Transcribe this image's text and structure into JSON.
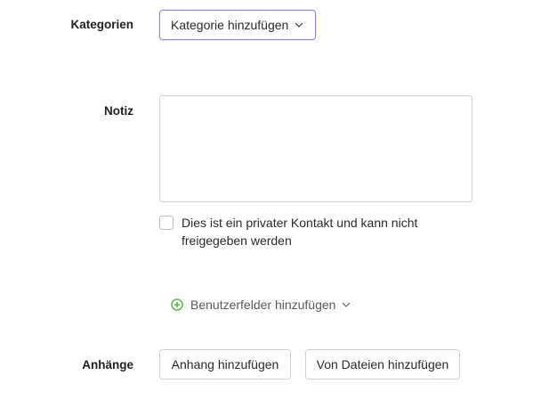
{
  "categories": {
    "label": "Kategorien",
    "dropdown_label": "Kategorie hinzufügen",
    "chevron_icon": "chevron-down-icon"
  },
  "note": {
    "label": "Notiz",
    "value": "",
    "placeholder": ""
  },
  "private_contact": {
    "checked": false,
    "text_line1": "Dies ist ein privater Kontakt und kann nicht",
    "text_line2": "freigegeben werden"
  },
  "custom_fields": {
    "label": "Benutzerfelder hinzufügen",
    "icon": "plus-circle-icon",
    "icon_color": "#3fae2a",
    "chevron_icon": "chevron-down-icon"
  },
  "attachments": {
    "label": "Anhänge",
    "add_button": "Anhang hinzufügen",
    "from_files_button": "Von Dateien hinzufügen"
  },
  "colors": {
    "dropdown_border": "#8e86e8",
    "input_border": "#cfd2d6"
  }
}
